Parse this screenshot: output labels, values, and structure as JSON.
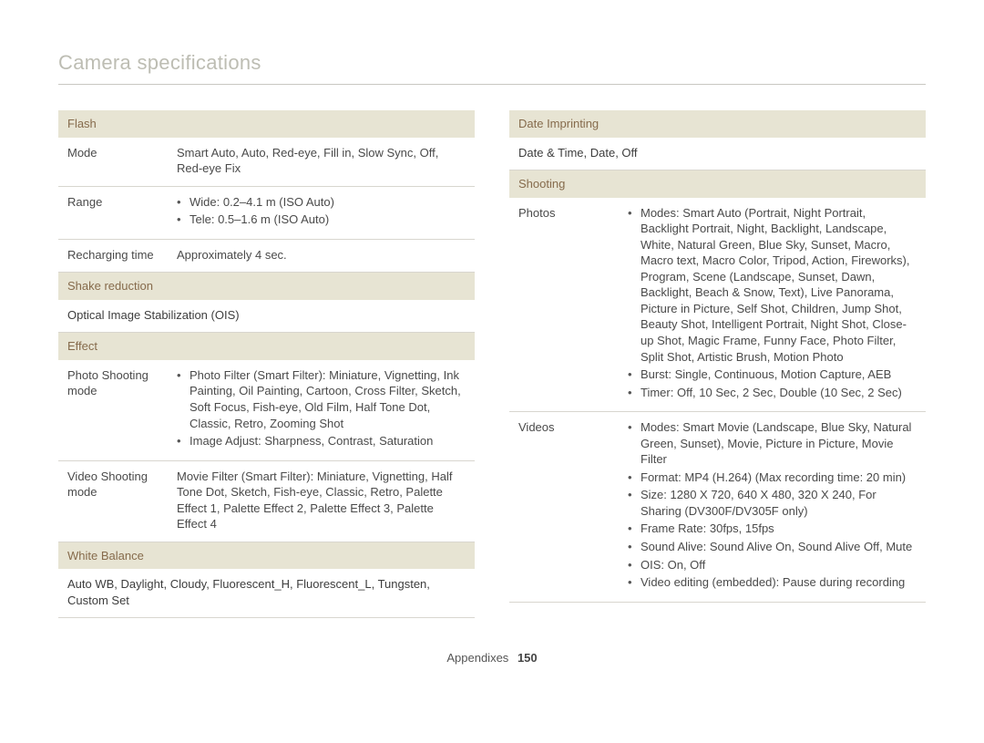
{
  "page_title": "Camera specifications",
  "footer": {
    "section": "Appendixes",
    "page": "150"
  },
  "left": {
    "flash": {
      "header": "Flash",
      "rows": {
        "mode_label": "Mode",
        "mode_value": "Smart Auto, Auto, Red-eye, Fill in, Slow Sync, Off, Red-eye Fix",
        "range_label": "Range",
        "range_items": [
          "Wide: 0.2–4.1 m (ISO Auto)",
          "Tele: 0.5–1.6 m (ISO Auto)"
        ],
        "recharge_label": "Recharging time",
        "recharge_value": "Approximately 4 sec."
      }
    },
    "shake": {
      "header": "Shake reduction",
      "value": "Optical Image Stabilization (OIS)"
    },
    "effect": {
      "header": "Effect",
      "photo_label": "Photo Shooting mode",
      "photo_items": [
        "Photo Filter (Smart Filter): Miniature, Vignetting, Ink Painting, Oil Painting, Cartoon, Cross Filter, Sketch, Soft Focus, Fish-eye, Old Film, Half Tone Dot, Classic, Retro, Zooming Shot",
        "Image Adjust: Sharpness, Contrast, Saturation"
      ],
      "video_label": "Video Shooting mode",
      "video_value": "Movie Filter (Smart Filter): Miniature, Vignetting, Half Tone Dot, Sketch, Fish-eye, Classic, Retro, Palette Effect 1, Palette Effect 2, Palette Effect 3, Palette Effect 4"
    },
    "wb": {
      "header": "White Balance",
      "value": "Auto WB, Daylight, Cloudy, Fluorescent_H, Fluorescent_L, Tungsten, Custom Set"
    }
  },
  "right": {
    "date": {
      "header": "Date Imprinting",
      "value": "Date & Time, Date, Off"
    },
    "shooting": {
      "header": "Shooting",
      "photos_label": "Photos",
      "photos_items": [
        "Modes: Smart Auto (Portrait, Night Portrait, Backlight Portrait, Night, Backlight, Landscape, White, Natural Green, Blue Sky, Sunset, Macro, Macro text, Macro Color, Tripod, Action, Fireworks), Program, Scene (Landscape, Sunset, Dawn, Backlight, Beach & Snow, Text), Live Panorama, Picture in Picture, Self Shot, Children, Jump Shot, Beauty Shot, Intelligent Portrait, Night Shot, Close-up Shot, Magic Frame, Funny Face, Photo Filter, Split Shot, Artistic Brush, Motion Photo",
        "Burst: Single, Continuous, Motion Capture, AEB",
        "Timer: Off, 10 Sec, 2 Sec, Double (10 Sec, 2 Sec)"
      ],
      "videos_label": "Videos",
      "videos_items": [
        "Modes: Smart Movie (Landscape, Blue Sky, Natural Green, Sunset), Movie, Picture in Picture, Movie Filter",
        "Format: MP4 (H.264) (Max recording time: 20 min)",
        "Size: 1280 X 720, 640 X 480, 320 X 240, For Sharing (DV300F/DV305F only)",
        "Frame Rate: 30fps, 15fps",
        "Sound Alive: Sound Alive On, Sound Alive Off, Mute",
        "OIS: On, Off",
        "Video editing (embedded): Pause during recording"
      ]
    }
  }
}
